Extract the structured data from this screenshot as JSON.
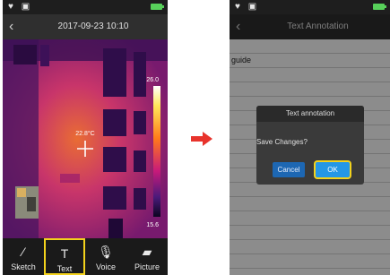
{
  "left_screen": {
    "status_icons": "♥ ▣",
    "title": "2017-09-23 10:10",
    "measurement": {
      "spot_temp": "22.8°C",
      "scale_max": "26.0",
      "scale_min": "15.6"
    },
    "toolbar": [
      {
        "label": "Sketch",
        "icon": "pen-icon",
        "glyph": "⁄",
        "selected": false
      },
      {
        "label": "Text",
        "icon": "text-icon",
        "glyph": "T",
        "selected": true
      },
      {
        "label": "Voice",
        "icon": "microphone-icon",
        "glyph": "🎙",
        "selected": false
      },
      {
        "label": "Picture",
        "icon": "picture-icon",
        "glyph": "▰",
        "selected": false
      }
    ]
  },
  "right_screen": {
    "status_icons": "♥ ▣",
    "title": "Text Annotation",
    "note_text": "guide",
    "dialog": {
      "title": "Text annotation",
      "message": "Save Changes?",
      "cancel_label": "Cancel",
      "ok_label": "OK"
    }
  },
  "colors": {
    "highlight": "#f3d21c",
    "arrow": "#e8332c",
    "battery": "#57d05a",
    "ok_button": "#2497e6"
  }
}
